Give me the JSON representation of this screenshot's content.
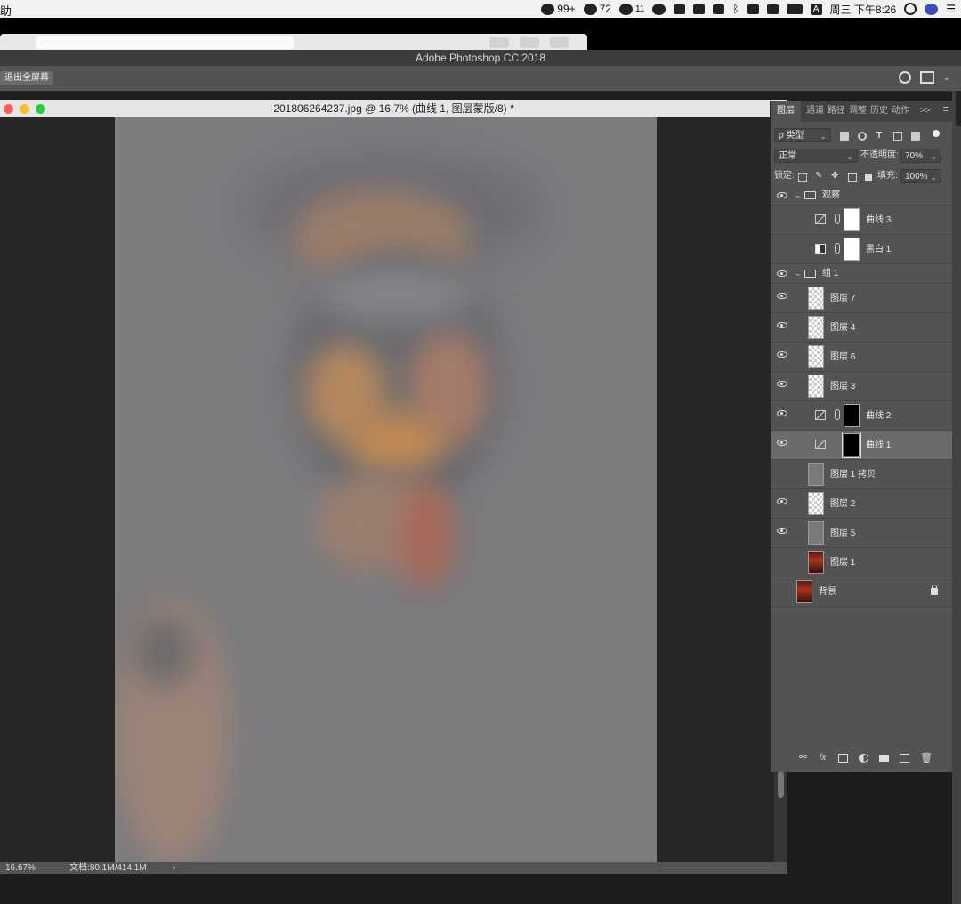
{
  "menubar": {
    "left_text": "助",
    "wechat_count": "99+",
    "qq_count": "72",
    "app_count": "11",
    "input_method": "A",
    "clock": "周三 下午8:26",
    "icons": [
      "wechat-icon",
      "qq-icon",
      "app-badge-icon",
      "creative-cloud-icon",
      "screen-icon",
      "menu-icon",
      "upload-icon",
      "bluetooth-icon",
      "wifi-icon",
      "airplay-icon",
      "battery-icon",
      "spotlight-icon",
      "siri-icon",
      "notification-center-icon"
    ]
  },
  "app": {
    "title": "Adobe Photoshop CC 2018",
    "fullscreen_label": "退出全屏幕"
  },
  "document": {
    "title": "20180626423​7.jpg @ 16.7% (曲线 1, 图层蒙版/8) *",
    "zoom": "16.67%",
    "doc_size": "文档:80.1M/414.1M",
    "status_arrow": "›"
  },
  "panel": {
    "tabs": [
      "图层",
      "通道",
      "路径",
      "调整",
      "历史",
      "动作"
    ],
    "tab_more": ">>",
    "filter_label": "ρ 类型",
    "blend_mode": "正常",
    "opacity_label": "不透明度:",
    "opacity_value": "70%",
    "lock_label": "锁定:",
    "fill_label": "填充:",
    "fill_value": "100%"
  },
  "layers": [
    {
      "name": "观察",
      "type": "group",
      "visible": true,
      "indent": 0
    },
    {
      "name": "曲线 3",
      "type": "curves-white",
      "visible": false,
      "indent": 1
    },
    {
      "name": "黑白 1",
      "type": "bw-white",
      "visible": false,
      "indent": 1
    },
    {
      "name": "组 1",
      "type": "group",
      "visible": true,
      "indent": 0
    },
    {
      "name": "图层 7",
      "type": "transparent",
      "visible": true,
      "indent": 1
    },
    {
      "name": "图层 4",
      "type": "transparent",
      "visible": true,
      "indent": 1
    },
    {
      "name": "图层 6",
      "type": "transparent",
      "visible": true,
      "indent": 1
    },
    {
      "name": "图层 3",
      "type": "transparent",
      "visible": true,
      "indent": 1
    },
    {
      "name": "曲线 2",
      "type": "curves-black",
      "visible": true,
      "indent": 1
    },
    {
      "name": "曲线 1",
      "type": "curves-black-selected",
      "visible": true,
      "indent": 1,
      "selected": true
    },
    {
      "name": "图层 1 拷贝",
      "type": "gray",
      "visible": false,
      "indent": 1
    },
    {
      "name": "图层 2",
      "type": "transparent",
      "visible": true,
      "indent": 1
    },
    {
      "name": "图层 5",
      "type": "gray",
      "visible": true,
      "indent": 1
    },
    {
      "name": "图层 1",
      "type": "photo",
      "visible": false,
      "indent": 1
    },
    {
      "name": "背景",
      "type": "photo-locked",
      "visible": false,
      "indent": 0
    }
  ],
  "footer_icons": [
    "link-layers-icon",
    "fx-icon",
    "add-mask-icon",
    "adjustment-icon",
    "new-group-icon",
    "new-layer-icon",
    "trash-icon"
  ]
}
